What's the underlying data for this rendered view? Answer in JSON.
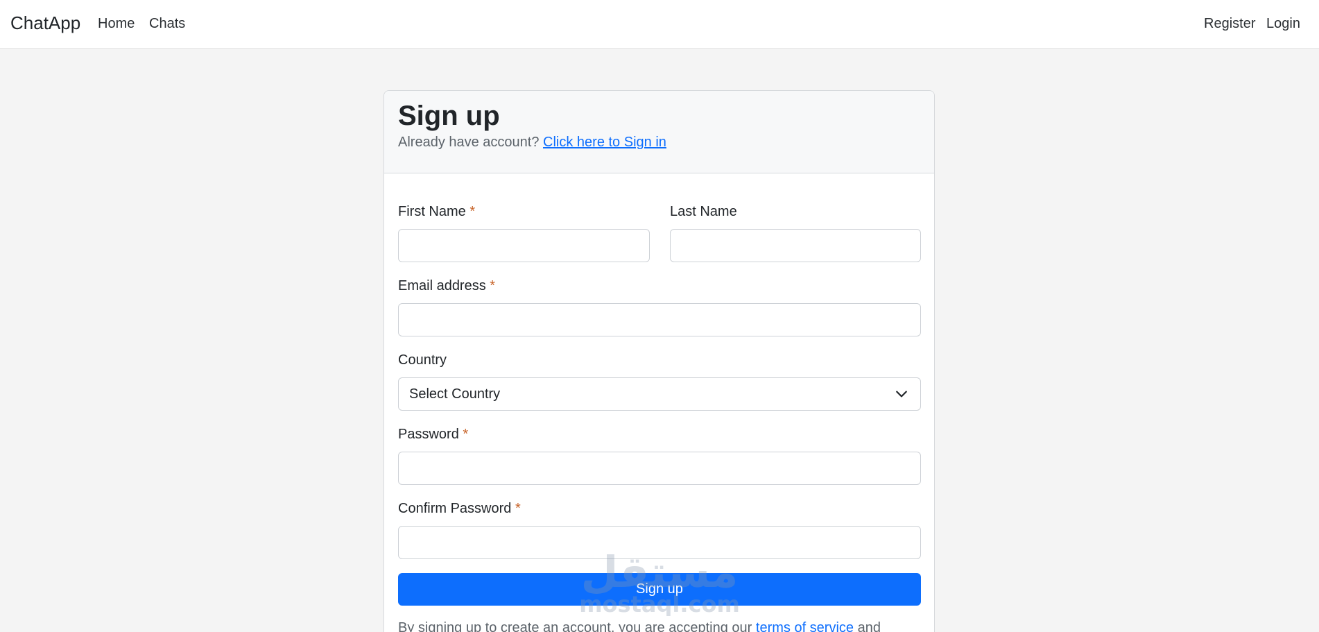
{
  "navbar": {
    "brand": "ChatApp",
    "links": [
      "Home",
      "Chats"
    ],
    "right_links": [
      "Register",
      "Login"
    ]
  },
  "card": {
    "title": "Sign up",
    "subtitle_text": "Already have account?",
    "signin_link": "Click here to Sign in"
  },
  "form": {
    "first_name_label": "First Name",
    "last_name_label": "Last Name",
    "email_label": "Email address",
    "country_label": "Country",
    "country_value": "Select Country",
    "password_label": "Password",
    "confirm_password_label": "Confirm Password",
    "required_mark": "*",
    "submit_label": "Sign up",
    "terms_text": "By signing up to create an account, you are accepting our",
    "terms_link": "terms of service",
    "terms_and": "and"
  },
  "watermark": {
    "arabic": "مستقل",
    "latin": "mostaql.com"
  },
  "colors": {
    "primary": "#0d6efd",
    "required": "#c8642a",
    "background": "#f4f4f4"
  }
}
